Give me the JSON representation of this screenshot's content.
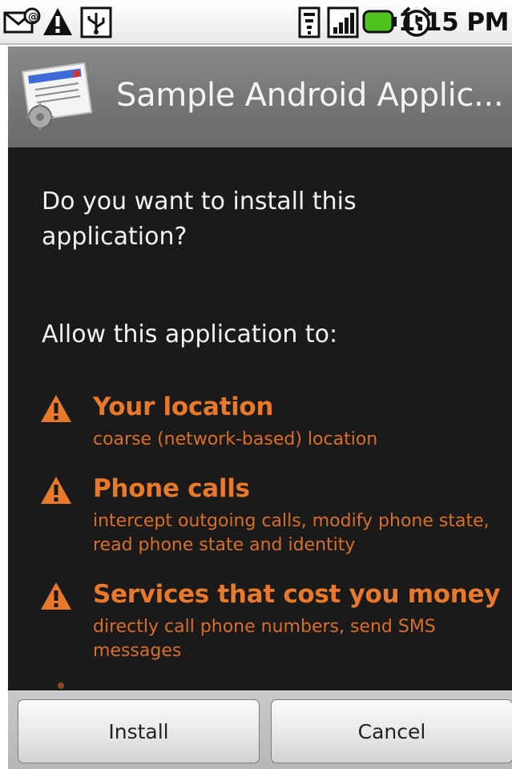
{
  "status_bar": {
    "time": "1:15 PM",
    "icons": [
      "email-icon",
      "warning-icon",
      "usb-icon",
      "wifi-icon",
      "signal-icon",
      "battery-icon",
      "alarm-icon"
    ]
  },
  "title_bar": {
    "title": "Sample Android Applic...",
    "icon": "app-installer-icon"
  },
  "dialog": {
    "question": "Do you want to install this application?",
    "allow_heading": "Allow this application to:",
    "permissions": [
      {
        "title": "Your location",
        "description": "coarse (network-based) location"
      },
      {
        "title": "Phone calls",
        "description": "intercept outgoing calls, modify phone state, read phone state and identity"
      },
      {
        "title": "Services that cost you money",
        "description": "directly call phone numbers, send SMS messages"
      }
    ]
  },
  "buttons": {
    "install": "Install",
    "cancel": "Cancel"
  },
  "colors": {
    "permission_accent": "#e8782a",
    "background": "#1a1a1a",
    "title_bar": "#7a7a7a"
  }
}
